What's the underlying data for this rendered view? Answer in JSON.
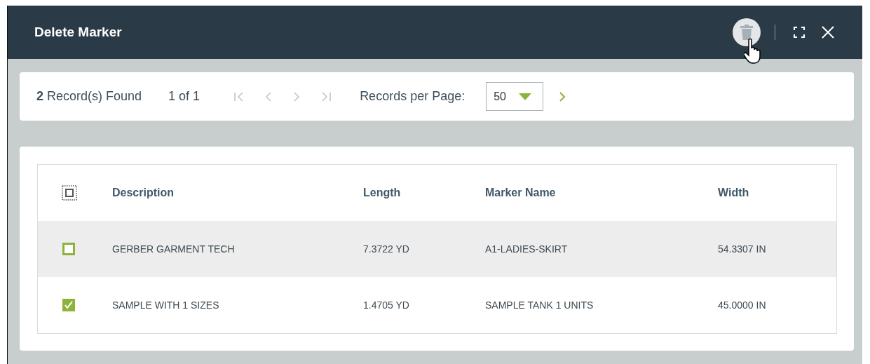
{
  "window": {
    "title": "Delete Marker"
  },
  "toolbar": {
    "records_found": "**2** Record(s) Found",
    "page": "1 of 1",
    "per_page_label": "Records per Page:",
    "per_page_value": "50"
  },
  "table": {
    "columns": [
      "Description",
      "Length",
      "Marker Name",
      "Width"
    ],
    "rows": [
      {
        "checked": false,
        "hovered": true,
        "cells": [
          "GERBER GARMENT TECH",
          "7.3722 YD",
          "A1-LADIES-SKIRT",
          "54.3307 IN"
        ]
      },
      {
        "checked": true,
        "hovered": false,
        "cells": [
          "SAMPLE WITH 1 SIZES",
          "1.4705 YD",
          "SAMPLE TANK 1 UNITS",
          "45.0000 IN"
        ]
      }
    ]
  }
}
